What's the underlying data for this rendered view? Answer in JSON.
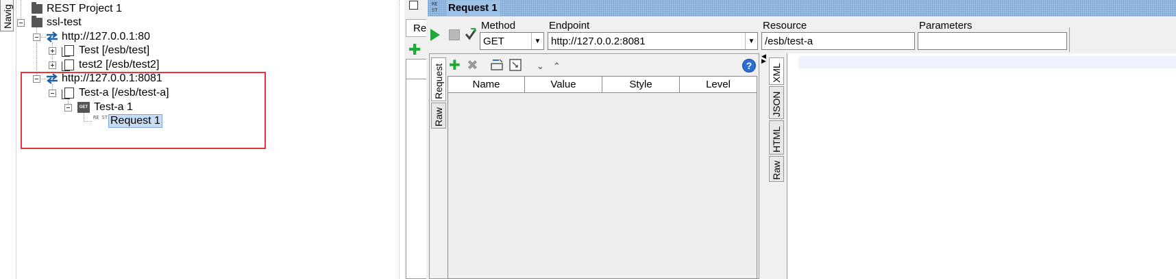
{
  "navigator": {
    "tab_label": "Navig"
  },
  "tree": {
    "project_rest": "REST Project 1",
    "project_ssl": "ssl-test",
    "endpoint1": "http://127.0.0.1:80",
    "resource_test": "Test [/esb/test]",
    "resource_test2": "test2 [/esb/test2]",
    "endpoint2": "http://127.0.0.1:8081",
    "resource_testa": "Test-a [/esb/test-a]",
    "method_testa1": "Test-a 1",
    "request1": "Request 1",
    "get_badge": "GET",
    "rest_badge": "RE ST"
  },
  "editor": {
    "title": "Request 1",
    "side_tab": "Re",
    "method_label": "Method",
    "method_value": "GET",
    "endpoint_label": "Endpoint",
    "endpoint_value": "http://127.0.0.2:8081",
    "resource_label": "Resource",
    "resource_value": "/esb/test-a",
    "parameters_label": "Parameters",
    "parameters_value": ""
  },
  "request_panel": {
    "tabs": [
      "Request",
      "Raw"
    ],
    "columns": [
      "Name",
      "Value",
      "Style",
      "Level"
    ],
    "help": "?"
  },
  "response_panel": {
    "tabs": [
      "XML",
      "JSON",
      "HTML",
      "Raw"
    ]
  },
  "colors": {
    "accent_green": "#20a83a",
    "highlight_red": "#e8333a",
    "selection_blue": "#c6dcf5",
    "title_blue": "#9ec1e6",
    "endpoint_icon_blue": "#1f5fa8"
  }
}
